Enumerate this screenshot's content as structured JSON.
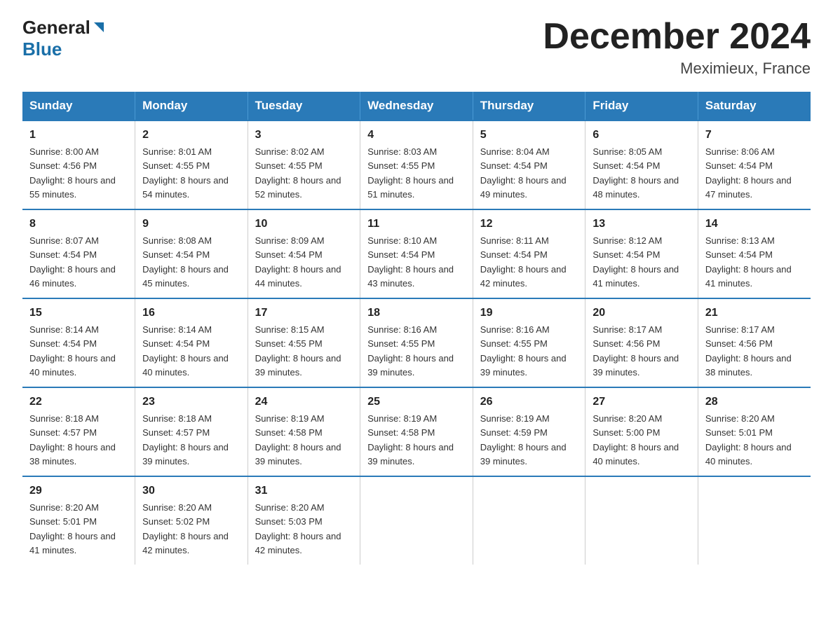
{
  "header": {
    "logo_general": "General",
    "logo_blue": "Blue",
    "month_title": "December 2024",
    "location": "Meximieux, France"
  },
  "weekdays": [
    "Sunday",
    "Monday",
    "Tuesday",
    "Wednesday",
    "Thursday",
    "Friday",
    "Saturday"
  ],
  "weeks": [
    [
      {
        "day": "1",
        "sunrise": "8:00 AM",
        "sunset": "4:56 PM",
        "daylight": "8 hours and 55 minutes."
      },
      {
        "day": "2",
        "sunrise": "8:01 AM",
        "sunset": "4:55 PM",
        "daylight": "8 hours and 54 minutes."
      },
      {
        "day": "3",
        "sunrise": "8:02 AM",
        "sunset": "4:55 PM",
        "daylight": "8 hours and 52 minutes."
      },
      {
        "day": "4",
        "sunrise": "8:03 AM",
        "sunset": "4:55 PM",
        "daylight": "8 hours and 51 minutes."
      },
      {
        "day": "5",
        "sunrise": "8:04 AM",
        "sunset": "4:54 PM",
        "daylight": "8 hours and 49 minutes."
      },
      {
        "day": "6",
        "sunrise": "8:05 AM",
        "sunset": "4:54 PM",
        "daylight": "8 hours and 48 minutes."
      },
      {
        "day": "7",
        "sunrise": "8:06 AM",
        "sunset": "4:54 PM",
        "daylight": "8 hours and 47 minutes."
      }
    ],
    [
      {
        "day": "8",
        "sunrise": "8:07 AM",
        "sunset": "4:54 PM",
        "daylight": "8 hours and 46 minutes."
      },
      {
        "day": "9",
        "sunrise": "8:08 AM",
        "sunset": "4:54 PM",
        "daylight": "8 hours and 45 minutes."
      },
      {
        "day": "10",
        "sunrise": "8:09 AM",
        "sunset": "4:54 PM",
        "daylight": "8 hours and 44 minutes."
      },
      {
        "day": "11",
        "sunrise": "8:10 AM",
        "sunset": "4:54 PM",
        "daylight": "8 hours and 43 minutes."
      },
      {
        "day": "12",
        "sunrise": "8:11 AM",
        "sunset": "4:54 PM",
        "daylight": "8 hours and 42 minutes."
      },
      {
        "day": "13",
        "sunrise": "8:12 AM",
        "sunset": "4:54 PM",
        "daylight": "8 hours and 41 minutes."
      },
      {
        "day": "14",
        "sunrise": "8:13 AM",
        "sunset": "4:54 PM",
        "daylight": "8 hours and 41 minutes."
      }
    ],
    [
      {
        "day": "15",
        "sunrise": "8:14 AM",
        "sunset": "4:54 PM",
        "daylight": "8 hours and 40 minutes."
      },
      {
        "day": "16",
        "sunrise": "8:14 AM",
        "sunset": "4:54 PM",
        "daylight": "8 hours and 40 minutes."
      },
      {
        "day": "17",
        "sunrise": "8:15 AM",
        "sunset": "4:55 PM",
        "daylight": "8 hours and 39 minutes."
      },
      {
        "day": "18",
        "sunrise": "8:16 AM",
        "sunset": "4:55 PM",
        "daylight": "8 hours and 39 minutes."
      },
      {
        "day": "19",
        "sunrise": "8:16 AM",
        "sunset": "4:55 PM",
        "daylight": "8 hours and 39 minutes."
      },
      {
        "day": "20",
        "sunrise": "8:17 AM",
        "sunset": "4:56 PM",
        "daylight": "8 hours and 39 minutes."
      },
      {
        "day": "21",
        "sunrise": "8:17 AM",
        "sunset": "4:56 PM",
        "daylight": "8 hours and 38 minutes."
      }
    ],
    [
      {
        "day": "22",
        "sunrise": "8:18 AM",
        "sunset": "4:57 PM",
        "daylight": "8 hours and 38 minutes."
      },
      {
        "day": "23",
        "sunrise": "8:18 AM",
        "sunset": "4:57 PM",
        "daylight": "8 hours and 39 minutes."
      },
      {
        "day": "24",
        "sunrise": "8:19 AM",
        "sunset": "4:58 PM",
        "daylight": "8 hours and 39 minutes."
      },
      {
        "day": "25",
        "sunrise": "8:19 AM",
        "sunset": "4:58 PM",
        "daylight": "8 hours and 39 minutes."
      },
      {
        "day": "26",
        "sunrise": "8:19 AM",
        "sunset": "4:59 PM",
        "daylight": "8 hours and 39 minutes."
      },
      {
        "day": "27",
        "sunrise": "8:20 AM",
        "sunset": "5:00 PM",
        "daylight": "8 hours and 40 minutes."
      },
      {
        "day": "28",
        "sunrise": "8:20 AM",
        "sunset": "5:01 PM",
        "daylight": "8 hours and 40 minutes."
      }
    ],
    [
      {
        "day": "29",
        "sunrise": "8:20 AM",
        "sunset": "5:01 PM",
        "daylight": "8 hours and 41 minutes."
      },
      {
        "day": "30",
        "sunrise": "8:20 AM",
        "sunset": "5:02 PM",
        "daylight": "8 hours and 42 minutes."
      },
      {
        "day": "31",
        "sunrise": "8:20 AM",
        "sunset": "5:03 PM",
        "daylight": "8 hours and 42 minutes."
      },
      null,
      null,
      null,
      null
    ]
  ],
  "labels": {
    "sunrise_prefix": "Sunrise: ",
    "sunset_prefix": "Sunset: ",
    "daylight_prefix": "Daylight: "
  }
}
